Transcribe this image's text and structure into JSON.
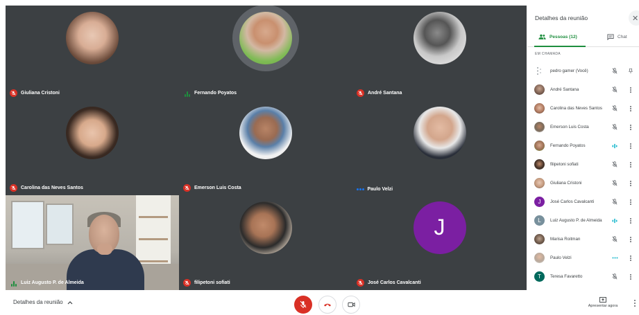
{
  "panel": {
    "title": "Detalhes da reunião",
    "close_icon": "close-icon",
    "tabs": [
      {
        "label": "Pessoas (12)",
        "icon": "people-icon",
        "active": true
      },
      {
        "label": "Chat",
        "icon": "chat-icon",
        "active": false
      }
    ],
    "section_label": "EM CHAMADA",
    "participants": [
      {
        "name": "pedro gamer (Você)",
        "avatar": "dots",
        "status": "muted",
        "extra_icon": "pin-icon"
      },
      {
        "name": "André Santana",
        "avatar": "photo",
        "status": "muted"
      },
      {
        "name": "Carolina das Neves Santos",
        "avatar": "photo",
        "status": "muted"
      },
      {
        "name": "Emerson Luis Costa",
        "avatar": "photo",
        "status": "muted"
      },
      {
        "name": "Fernando Poyatos",
        "avatar": "photo",
        "status": "speaking"
      },
      {
        "name": "filipetoni sofiati",
        "avatar": "photo",
        "status": "muted"
      },
      {
        "name": "Giuliana Cristoni",
        "avatar": "photo",
        "status": "muted"
      },
      {
        "name": "José Carlos Cavalcanti",
        "avatar": "letter",
        "letter": "J",
        "avatar_color": "#7b1fa2",
        "status": "muted"
      },
      {
        "name": "Luiz Augusto P. de Almeida",
        "avatar": "letter",
        "letter": "L",
        "avatar_color": "#78909c",
        "status": "speaking"
      },
      {
        "name": "Marisa Roitman",
        "avatar": "photo",
        "status": "muted"
      },
      {
        "name": "Paulo Velzi",
        "avatar": "photo",
        "status": "connecting"
      },
      {
        "name": "Teresa Favaretto",
        "avatar": "letter",
        "letter": "T",
        "avatar_color": "#00695c",
        "status": "muted"
      }
    ]
  },
  "tiles": [
    {
      "name": "Giuliana Cristoni",
      "status": "muted",
      "kind": "photo"
    },
    {
      "name": "Fernando Poyatos",
      "status": "speaking",
      "kind": "photo"
    },
    {
      "name": "André Santana",
      "status": "muted",
      "kind": "photo"
    },
    {
      "name": "Carolina das Neves Santos",
      "status": "muted",
      "kind": "photo"
    },
    {
      "name": "Emerson Luis Costa",
      "status": "muted",
      "kind": "photo"
    },
    {
      "name": "Paulo Velzi",
      "status": "connecting",
      "kind": "photo"
    },
    {
      "name": "Luiz Augusto P. de Almeida",
      "status": "speaking",
      "kind": "video"
    },
    {
      "name": "filipetoni sofiati",
      "status": "muted",
      "kind": "photo"
    },
    {
      "name": "José Carlos Cavalcanti",
      "status": "muted",
      "kind": "letter",
      "letter": "J"
    }
  ],
  "bottom": {
    "meeting_details_label": "Detalhes da reunião",
    "present_label": "Apresentar agora",
    "colors": {
      "mic_off": "#d93025",
      "hangup": "#d93025",
      "speaking": "#1e8e3e",
      "accent": "#1e8e3e"
    }
  }
}
